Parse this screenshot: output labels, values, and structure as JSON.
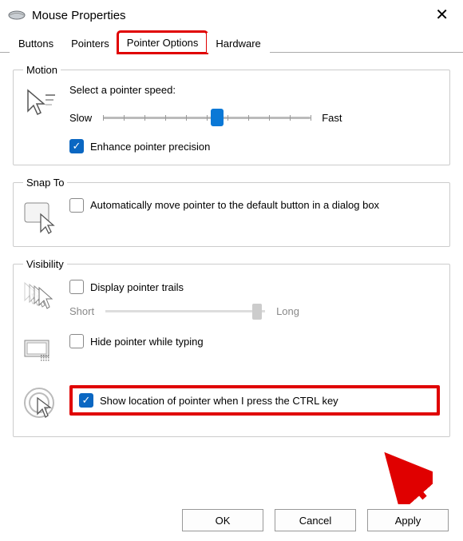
{
  "window": {
    "title": "Mouse Properties"
  },
  "tabs": {
    "buttons": "Buttons",
    "pointers": "Pointers",
    "pointer_options": "Pointer Options",
    "hardware": "Hardware"
  },
  "motion": {
    "legend": "Motion",
    "select_speed": "Select a pointer speed:",
    "slow": "Slow",
    "fast": "Fast",
    "slider_value_pct": 55,
    "enhance_precision": "Enhance pointer precision",
    "enhance_precision_checked": true
  },
  "snap_to": {
    "legend": "Snap To",
    "auto_move": "Automatically move pointer to the default button in a dialog box",
    "auto_move_checked": false
  },
  "visibility": {
    "legend": "Visibility",
    "display_trails": "Display pointer trails",
    "display_trails_checked": false,
    "short": "Short",
    "long": "Long",
    "trail_value_pct": 95,
    "hide_typing": "Hide pointer while typing",
    "hide_typing_checked": false,
    "show_ctrl": "Show location of pointer when I press the CTRL key",
    "show_ctrl_checked": true
  },
  "buttons": {
    "ok": "OK",
    "cancel": "Cancel",
    "apply": "Apply"
  }
}
